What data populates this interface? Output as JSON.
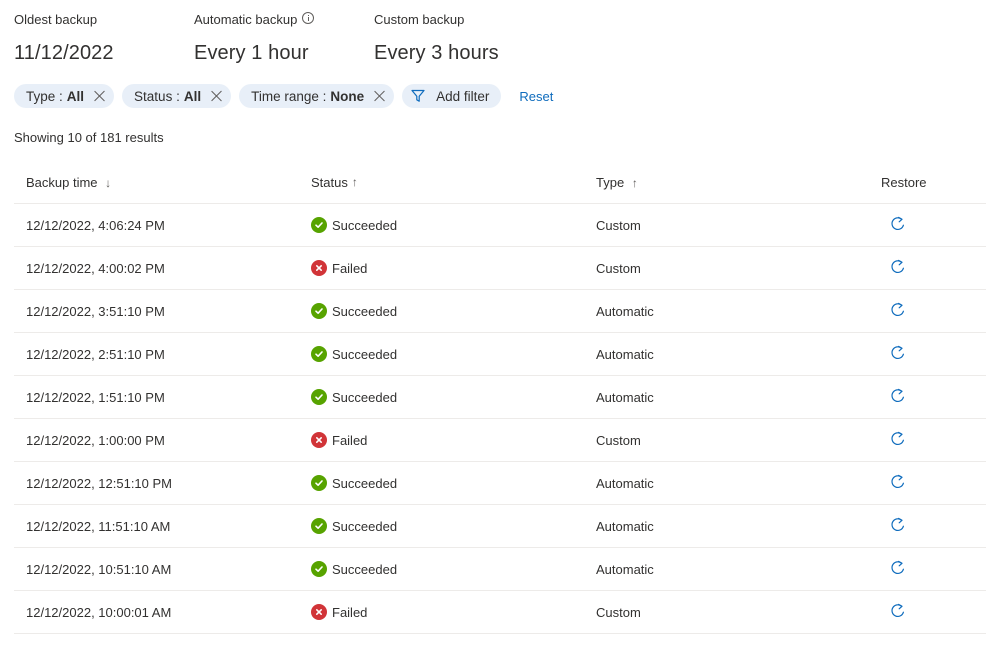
{
  "summary": {
    "oldest": {
      "label": "Oldest backup",
      "value": "11/12/2022"
    },
    "automatic": {
      "label": "Automatic backup",
      "value": "Every 1 hour"
    },
    "custom": {
      "label": "Custom backup",
      "value": "Every 3 hours"
    }
  },
  "filters": [
    {
      "key": "Type :",
      "value": "All"
    },
    {
      "key": "Status :",
      "value": "All"
    },
    {
      "key": "Time range :",
      "value": "None"
    }
  ],
  "add_filter_label": "Add filter",
  "reset_label": "Reset",
  "results_text": "Showing 10 of 181 results",
  "columns": {
    "backup_time": "Backup time",
    "backup_time_sort": "↓",
    "status": "Status",
    "status_sort": "↑",
    "type": "Type",
    "type_sort": "↑",
    "restore": "Restore"
  },
  "rows": [
    {
      "time": "12/12/2022, 4:06:24 PM",
      "status": "Succeeded",
      "type": "Custom"
    },
    {
      "time": "12/12/2022, 4:00:02 PM",
      "status": "Failed",
      "type": "Custom"
    },
    {
      "time": "12/12/2022, 3:51:10 PM",
      "status": "Succeeded",
      "type": "Automatic"
    },
    {
      "time": "12/12/2022, 2:51:10 PM",
      "status": "Succeeded",
      "type": "Automatic"
    },
    {
      "time": "12/12/2022, 1:51:10 PM",
      "status": "Succeeded",
      "type": "Automatic"
    },
    {
      "time": "12/12/2022, 1:00:00 PM",
      "status": "Failed",
      "type": "Custom"
    },
    {
      "time": "12/12/2022, 12:51:10 PM",
      "status": "Succeeded",
      "type": "Automatic"
    },
    {
      "time": "12/12/2022, 11:51:10 AM",
      "status": "Succeeded",
      "type": "Automatic"
    },
    {
      "time": "12/12/2022, 10:51:10 AM",
      "status": "Succeeded",
      "type": "Automatic"
    },
    {
      "time": "12/12/2022, 10:00:01 AM",
      "status": "Failed",
      "type": "Custom"
    }
  ],
  "colors": {
    "success": "#57a300",
    "failure": "#d13438",
    "link": "#0f6cbd",
    "pill_bg": "#e8eff8"
  },
  "icons": {
    "info": "info-icon",
    "filter": "filter-icon",
    "remove": "close-icon",
    "success": "checkmark-circle-icon",
    "failure": "error-circle-icon",
    "restore": "restore-icon"
  }
}
